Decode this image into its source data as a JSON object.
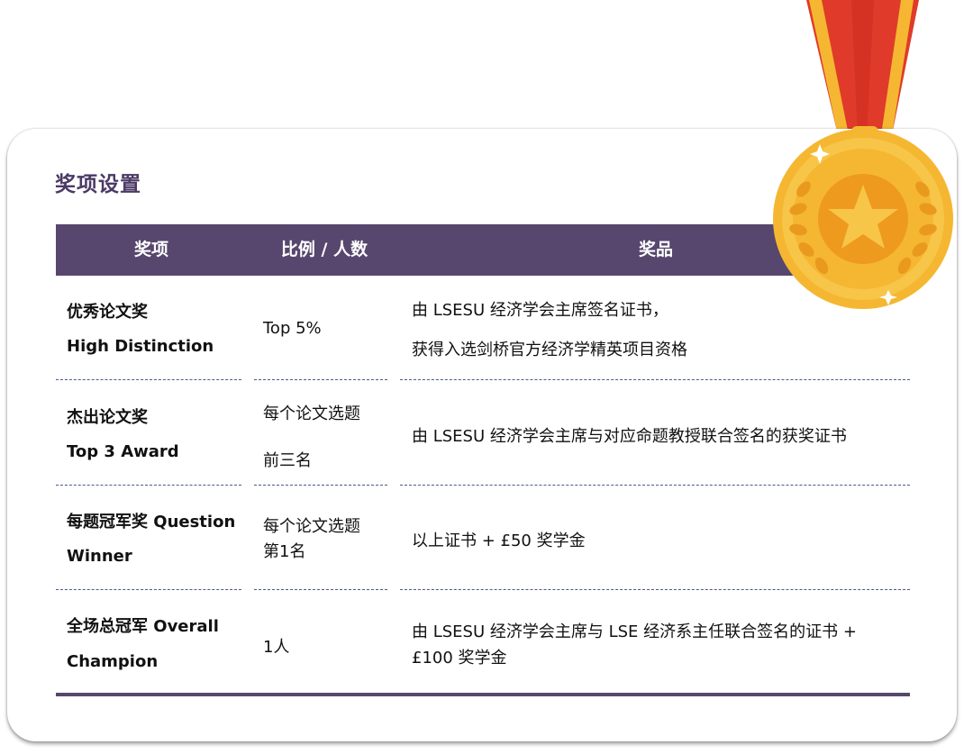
{
  "title": "奖项设置",
  "table": {
    "headers": [
      "奖项",
      "比例 / 人数",
      "奖品"
    ],
    "rows": [
      {
        "award": [
          "优秀论文奖",
          "High Distinction"
        ],
        "ratio": [
          "Top 5%"
        ],
        "prize": [
          "由 LSESU 经济学会主席签名证书，",
          "获得入选剑桥官方经济学精英项目资格"
        ]
      },
      {
        "award": [
          "杰出论文奖",
          "Top 3 Award"
        ],
        "ratio": [
          "每个论文选题",
          "前三名"
        ],
        "prize": [
          "由 LSESU 经济学会主席与对应命题教授联合签名的获奖证书"
        ]
      },
      {
        "award": [
          "每题冠军奖 Question",
          "Winner"
        ],
        "ratio": [
          "每个论文选题",
          "第1名"
        ],
        "prize": [
          "以上证书 + £50 奖学金"
        ]
      },
      {
        "award": [
          "全场总冠军 Overall",
          "Champion"
        ],
        "ratio": [
          "1人"
        ],
        "prize": [
          "由 LSESU 经济学会主席与 LSE 经济系主任联合签名的证书 +",
          "£100 奖学金"
        ]
      }
    ]
  },
  "colors": {
    "header_bg": "#57466d",
    "title": "#4b3a66",
    "separator": "#4b5a8a",
    "medal_gold": "#f5b731",
    "ribbon_red": "#e03a2a"
  },
  "icons": {
    "medal": "gold-medal-icon"
  }
}
